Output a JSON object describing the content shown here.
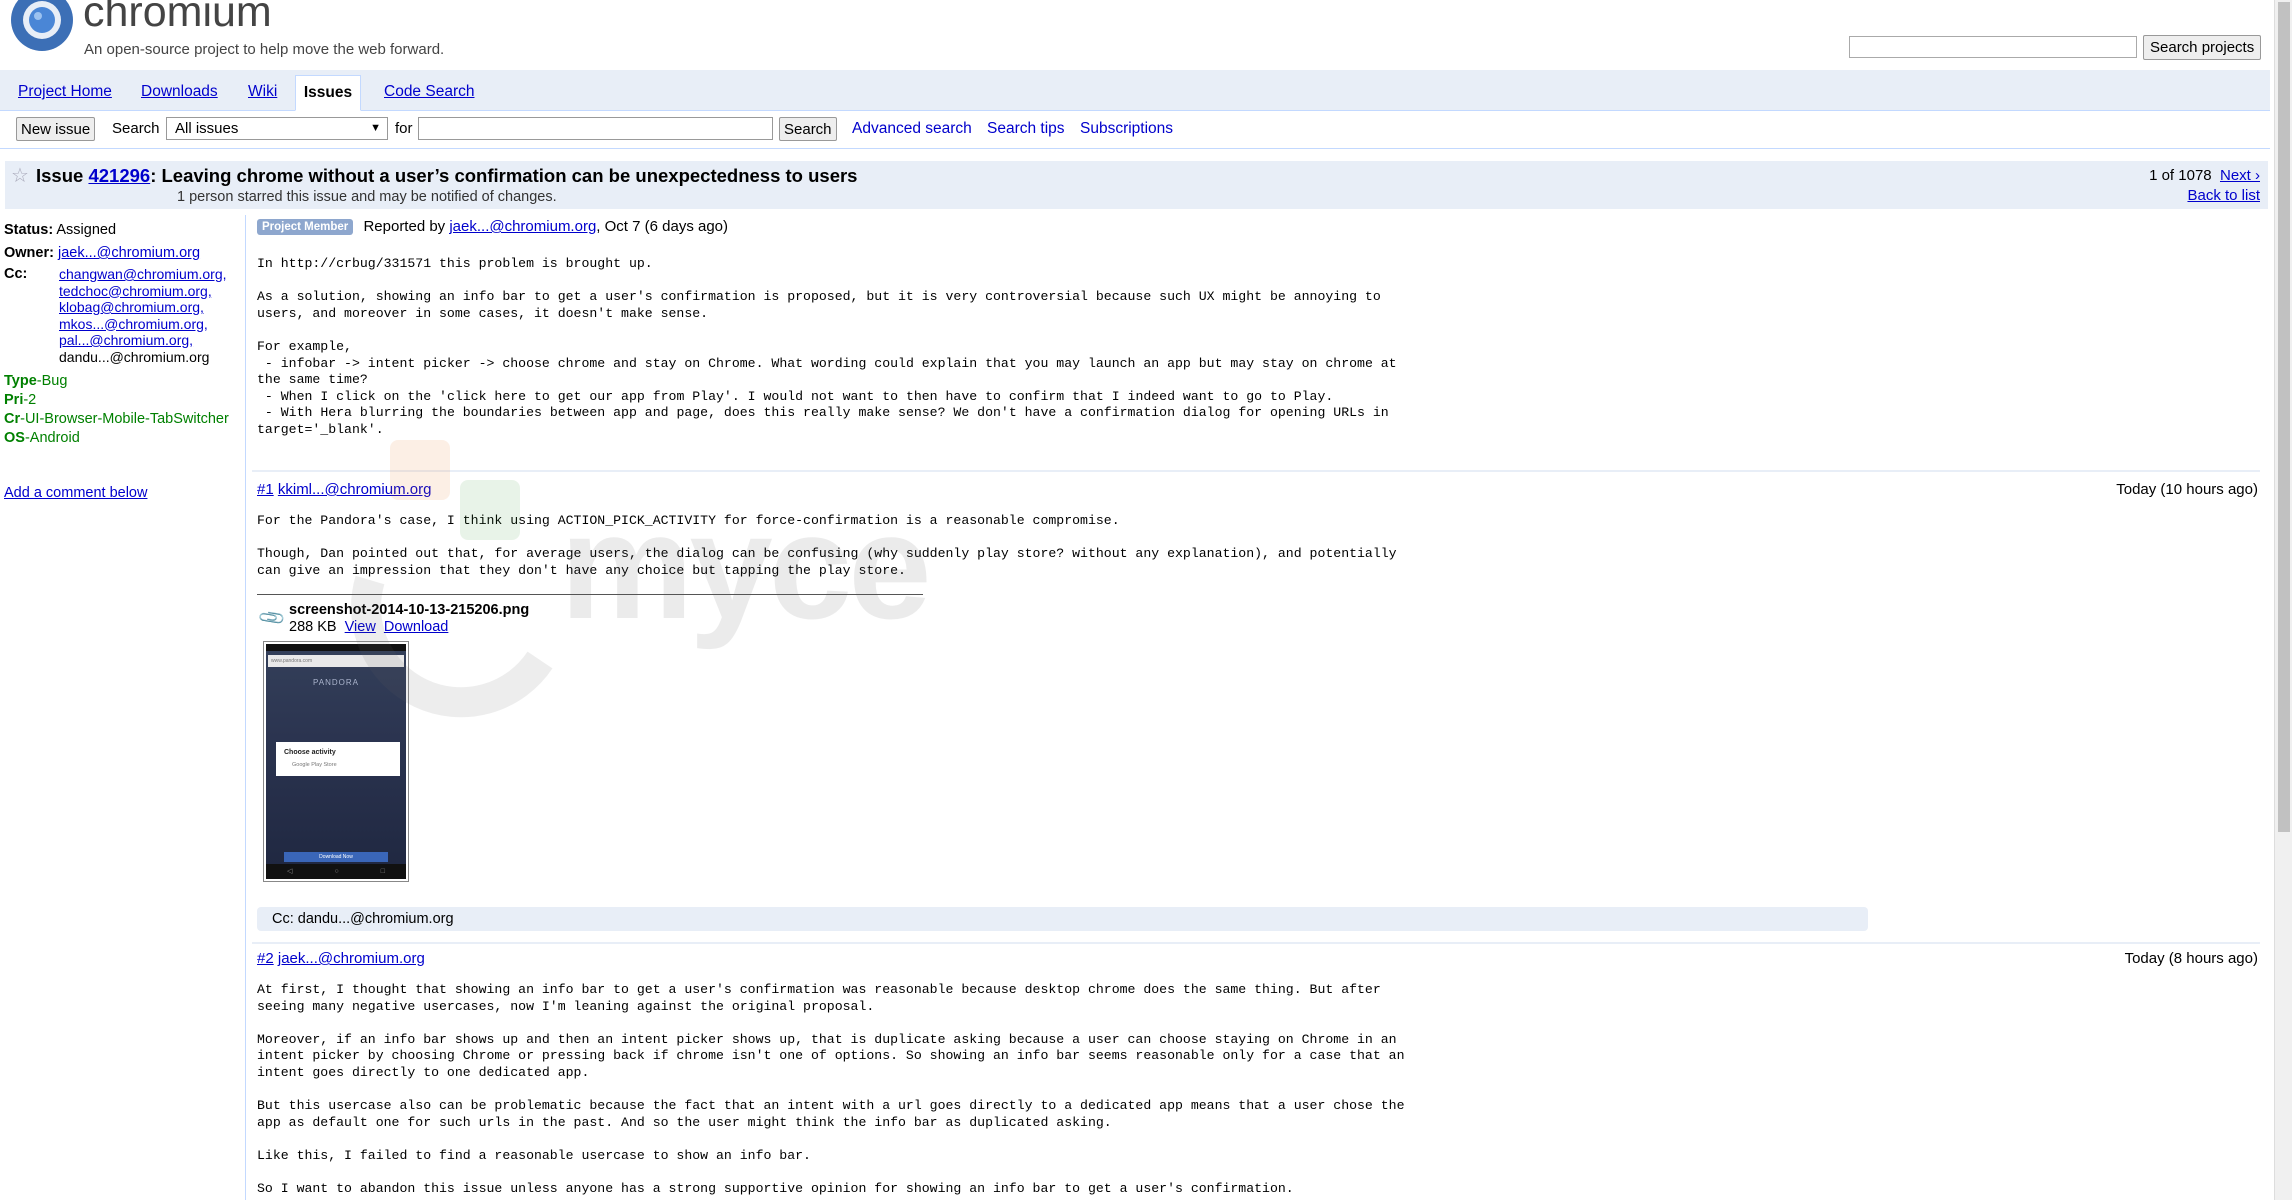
{
  "header": {
    "title": "chromium",
    "subtitle": "An open-source project to help move the web forward.",
    "search_projects_label": "Search projects"
  },
  "tabs": [
    {
      "label": "Project Home"
    },
    {
      "label": "Downloads"
    },
    {
      "label": "Wiki"
    },
    {
      "label": "Issues"
    },
    {
      "label": "Code Search"
    }
  ],
  "toolbar": {
    "new_issue_label": "New issue",
    "search_label": "Search",
    "scope_value": "All issues",
    "for_label": "for",
    "search_button": "Search",
    "advanced_search": "Advanced search",
    "search_tips": "Search tips",
    "subscriptions": "Subscriptions"
  },
  "issue": {
    "prefix": "Issue",
    "id": "421296",
    "title": ": Leaving chrome without a user’s confirmation can be unexpectedness to users",
    "starred_note": "1 person starred this issue and may be notified of changes.",
    "pager_count": "1 of 1078",
    "next": "Next ›",
    "back": "Back to list"
  },
  "meta": {
    "status_key": "Status:",
    "status_value": "Assigned",
    "owner_key": "Owner:",
    "owner_value": "jaek...@chromium.org",
    "cc_key": "Cc:",
    "cc": [
      "changwan@chromium.org,",
      "tedchoc@chromium.org,",
      "klobag@chromium.org,",
      "mkos...@chromium.org,",
      "pal...@chromium.org,",
      "dandu...@chromium.org"
    ],
    "labels": [
      {
        "key": "Type",
        "value": "-Bug"
      },
      {
        "key": "Pri",
        "value": "-2"
      },
      {
        "key": "Cr",
        "value": "-UI-Browser-Mobile-TabSwitcher"
      },
      {
        "key": "OS",
        "value": "-Android"
      }
    ],
    "add_comment": "Add a comment below"
  },
  "description": {
    "badge": "Project Member",
    "reported_by": "Reported by",
    "author": "jaek...@chromium.org",
    "date": ", Oct 7 (6 days ago)",
    "body": "In http://crbug/331571 this problem is brought up.\n\nAs a solution, showing an info bar to get a user's confirmation is proposed, but it is very controversial because such UX might be annoying to\nusers, and moreover in some cases, it doesn't make sense.\n\nFor example,\n - infobar -> intent picker -> choose chrome and stay on Chrome. What wording could explain that you may launch an app but may stay on chrome at\nthe same time?\n - When I click on the 'click here to get our app from Play'. I would not want to then have to confirm that I indeed want to go to Play.\n - With Hera blurring the boundaries between app and page, does this really make sense? We don't have a confirmation dialog for opening URLs in\ntarget='_blank'."
  },
  "comments": [
    {
      "num": "#1",
      "author": "kkiml...@chromium.org",
      "time": "Today (10 hours ago)",
      "body": "For the Pandora's case, I think using ACTION_PICK_ACTIVITY for force-confirmation is a reasonable compromise.\n\nThough, Dan pointed out that, for average users, the dialog can be confusing (why suddenly play store? without any explanation), and potentially\ncan give an impression that they don't have any choice but tapping the play store.",
      "attachment": {
        "name": "screenshot-2014-10-13-215206.png",
        "size": "288 KB",
        "view": "View",
        "download": "Download",
        "thumb_brand": "PANDORA",
        "thumb_url": "www.pandora.com",
        "thumb_dialog_title": "Choose activity",
        "thumb_dialog_item": "Google Play Store",
        "thumb_cta": "Download Now"
      },
      "cc_change": "Cc: dandu...@chromium.org"
    },
    {
      "num": "#2",
      "author": "jaek...@chromium.org",
      "time": "Today (8 hours ago)",
      "body": "At first, I thought that showing an info bar to get a user's confirmation was reasonable because desktop chrome does the same thing. But after\nseeing many negative usercases, now I'm leaning against the original proposal.\n\nMoreover, if an info bar shows up and then an intent picker shows up, that is duplicate asking because a user can choose staying on Chrome in an\nintent picker by choosing Chrome or pressing back if chrome isn't one of options. So showing an info bar seems reasonable only for a case that an\nintent goes directly to one dedicated app.\n\nBut this usercase also can be problematic because the fact that an intent with a url goes directly to a dedicated app means that a user chose the\napp as default one for such urls in the past. And so the user might think the info bar as duplicated asking.\n\nLike this, I failed to find a reasonable usercase to show an info bar.\n\nSo I want to abandon this issue unless anyone has a strong supportive opinion for showing an info bar to get a user's confirmation."
    }
  ],
  "watermark": "mycе",
  "colors": {
    "link": "#0000cc",
    "tab_bg": "#e8eef7",
    "border": "#c3d9ff",
    "label_green": "#008000",
    "badge": "#8ea7ce"
  }
}
